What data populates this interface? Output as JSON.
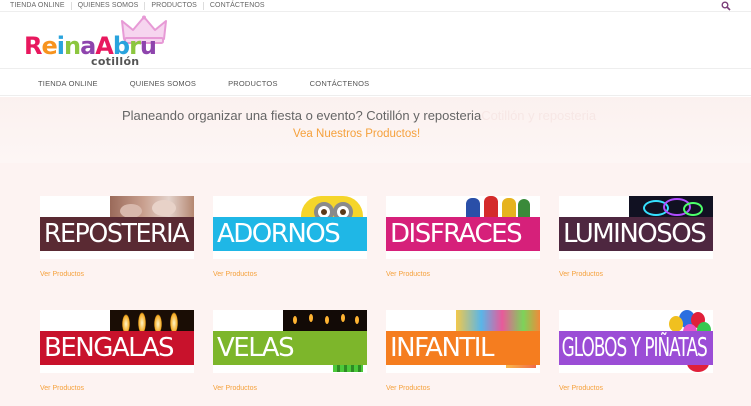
{
  "topbar": {
    "items": [
      "TIENDA ONLINE",
      "QUIENES SOMOS",
      "PRODUCTOS",
      "CONTÁCTENOS"
    ],
    "search_icon": "search-icon"
  },
  "logo": {
    "text": "ReinaAbru",
    "letters": [
      {
        "ch": "R",
        "color": "#e8185e"
      },
      {
        "ch": "e",
        "color": "#f7931e"
      },
      {
        "ch": "i",
        "color": "#29a3dd"
      },
      {
        "ch": "n",
        "color": "#8cc63f"
      },
      {
        "ch": "a",
        "color": "#8e44ad"
      },
      {
        "ch": "A",
        "color": "#e8185e"
      },
      {
        "ch": "b",
        "color": "#29a3dd"
      },
      {
        "ch": "r",
        "color": "#8cc63f"
      },
      {
        "ch": "u",
        "color": "#8e44ad"
      }
    ],
    "subtitle": "cotillón",
    "crown_color": "#e79ad6"
  },
  "mainnav": {
    "items": [
      "TIENDA ONLINE",
      "QUIENES SOMOS",
      "PRODUCTOS",
      "CONTÁCTENOS"
    ]
  },
  "hero": {
    "line1": "Planeando organizar una fiesta o evento? Cotillón y reposteria",
    "line1_faded": "Cotillón y reposteria",
    "line2": "Vea Nuestros Productos!"
  },
  "categories": [
    {
      "label": "REPOSTERIA",
      "color": "#5a2a33",
      "link": "Ver Productos",
      "photo": "cupcakes"
    },
    {
      "label": "ADORNOS",
      "color": "#1fb7e6",
      "link": "Ver Productos",
      "photo": "minion"
    },
    {
      "label": "DISFRACES",
      "color": "#d6207a",
      "link": "Ver Productos",
      "photo": "costumes"
    },
    {
      "label": "LUMINOSOS",
      "color": "#4e2740",
      "link": "Ver Productos",
      "photo": "glowsticks"
    },
    {
      "label": "BENGALAS",
      "color": "#c8122c",
      "link": "Ver Productos",
      "photo": "sparklers"
    },
    {
      "label": "VELAS",
      "color": "#7db62b",
      "link": "Ver Productos",
      "photo": "candles"
    },
    {
      "label": "INFANTIL",
      "color": "#f57d1f",
      "link": "Ver Productos",
      "photo": "kids-party"
    },
    {
      "label": "GLOBOS Y PIÑATAS",
      "color": "#9b4dd6",
      "link": "Ver Productos",
      "photo": "balloons"
    }
  ]
}
